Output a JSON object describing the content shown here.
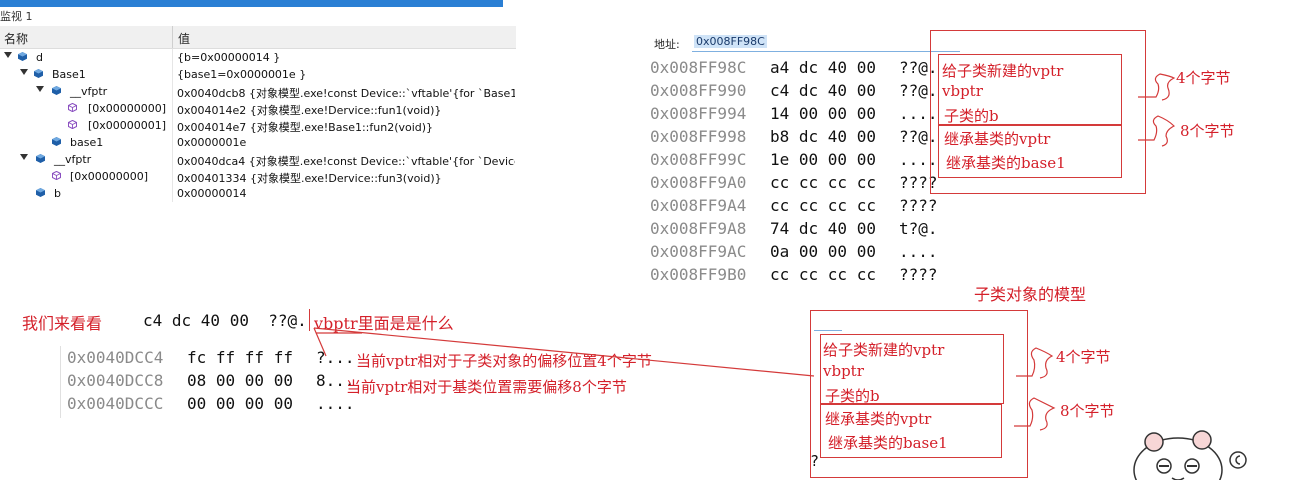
{
  "watch": {
    "title": "监视 1",
    "col_name": "名称",
    "col_value": "值",
    "rows": [
      {
        "name": "d",
        "value": "{b=0x00000014 }"
      },
      {
        "name": "Base1",
        "value": "{base1=0x0000001e }"
      },
      {
        "name": "__vfptr",
        "value": "0x0040dcb8 {对象模型.exe!const Device::`vftable'{for `Base1'}} {0"
      },
      {
        "name": "[0x00000000]",
        "value": "0x004014e2 {对象模型.exe!Dervice::fun1(void)}"
      },
      {
        "name": "[0x00000001]",
        "value": "0x004014e7 {对象模型.exe!Base1::fun2(void)}"
      },
      {
        "name": "base1",
        "value": "0x0000001e"
      },
      {
        "name": "__vfptr",
        "value": "0x0040dca4 {对象模型.exe!const Device::`vftable'{for `Device'}}"
      },
      {
        "name": "[0x00000000]",
        "value": "0x00401334 {对象模型.exe!Dervice::fun3(void)}"
      },
      {
        "name": "b",
        "value": "0x00000014"
      }
    ]
  },
  "memory": {
    "address_label": "地址:",
    "address_value": "0x008FF98C",
    "rows": [
      {
        "addr": "0x008FF98C",
        "bytes": "a4 dc 40 00",
        "ascii": "??@."
      },
      {
        "addr": "0x008FF990",
        "bytes": "c4 dc 40 00",
        "ascii": "??@."
      },
      {
        "addr": "0x008FF994",
        "bytes": "14 00 00 00",
        "ascii": "...."
      },
      {
        "addr": "0x008FF998",
        "bytes": "b8 dc 40 00",
        "ascii": "??@."
      },
      {
        "addr": "0x008FF99C",
        "bytes": "1e 00 00 00",
        "ascii": "...."
      },
      {
        "addr": "0x008FF9A0",
        "bytes": "cc cc cc cc",
        "ascii": "????"
      },
      {
        "addr": "0x008FF9A4",
        "bytes": "cc cc cc cc",
        "ascii": "????"
      },
      {
        "addr": "0x008FF9A8",
        "bytes": "74 dc 40 00",
        "ascii": "t?@."
      },
      {
        "addr": "0x008FF9AC",
        "bytes": "0a 00 00 00",
        "ascii": "...."
      },
      {
        "addr": "0x008FF9B0",
        "bytes": "cc cc cc cc",
        "ascii": "????"
      }
    ]
  },
  "annotations_top": {
    "l1": "给子类新建的vptr",
    "l2": "vbptr",
    "l3": "子类的b",
    "l4": "继承基类的vptr",
    "l5": "继承基类的base1",
    "b4": "4个字节",
    "b8": "8个字节",
    "model_title": "子类对象的模型"
  },
  "lower": {
    "look": "我们来看看",
    "inline_hex": "c4 dc 40 00  ??@.",
    "inline_note": "vbptr里面是是什么",
    "rows": [
      {
        "addr": "0x0040DCC4",
        "bytes": "fc ff ff ff",
        "ascii": "?...",
        "note": "当前vptr相对于子类对象的偏移位置4个字节"
      },
      {
        "addr": "0x0040DCC8",
        "bytes": "08 00 00 00",
        "ascii": "8...",
        "note": "当前vptr相对于基类位置需要偏移8个字节"
      },
      {
        "addr": "0x0040DCCC",
        "bytes": "00 00 00 00",
        "ascii": "....",
        "note": ""
      }
    ]
  },
  "model": {
    "l1": "给子类新建的vptr",
    "l2": "vbptr",
    "l3": "子类的b",
    "l4": "继承基类的vptr",
    "l5": "继承基类的base1",
    "b4": "4个字节",
    "b8": "8个字节",
    "q": "?"
  },
  "colors": {
    "accent": "#2a7fd4",
    "annotation": "#d4202a"
  }
}
